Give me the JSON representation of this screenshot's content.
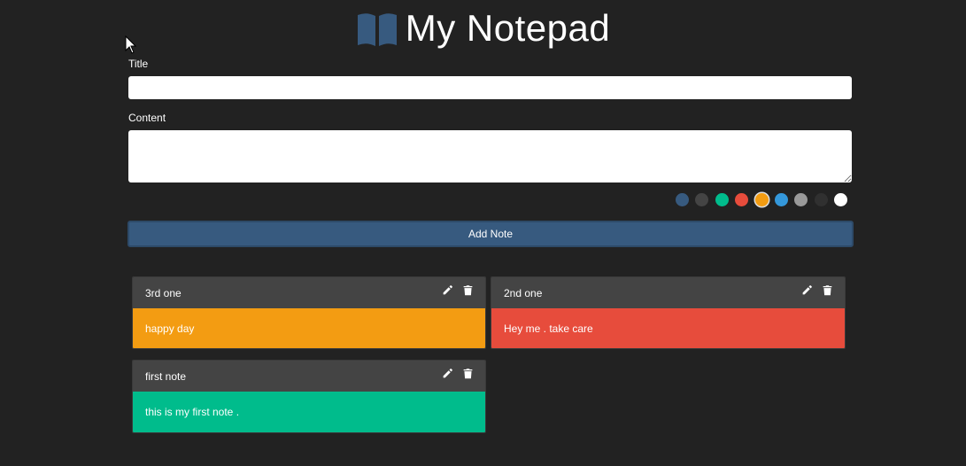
{
  "app": {
    "title": "My Notepad",
    "icon": "open-book-icon",
    "accent_color": "#375a7f"
  },
  "form": {
    "title_label": "Title",
    "title_value": "",
    "content_label": "Content",
    "content_value": "",
    "colors": [
      {
        "name": "dark-blue",
        "hex": "#375a7f",
        "selected": false
      },
      {
        "name": "dark-gray",
        "hex": "#444444",
        "selected": false
      },
      {
        "name": "green",
        "hex": "#00bc8c",
        "selected": false
      },
      {
        "name": "red",
        "hex": "#e74c3c",
        "selected": false
      },
      {
        "name": "orange",
        "hex": "#f39c12",
        "selected": true
      },
      {
        "name": "blue",
        "hex": "#3498db",
        "selected": false
      },
      {
        "name": "gray",
        "hex": "#999999",
        "selected": false
      },
      {
        "name": "near-black",
        "hex": "#303030",
        "selected": false
      },
      {
        "name": "white",
        "hex": "#ffffff",
        "selected": false
      }
    ],
    "add_button_label": "Add Note"
  },
  "notes": [
    {
      "title": "3rd one",
      "content": "happy day",
      "color": "#f39c12",
      "edit_icon": "pencil-icon",
      "delete_icon": "trash-icon"
    },
    {
      "title": "2nd one",
      "content": "Hey me . take care",
      "color": "#e74c3c",
      "edit_icon": "pencil-icon",
      "delete_icon": "trash-icon"
    },
    {
      "title": "first note",
      "content": "this is my first note .",
      "color": "#00bc8c",
      "edit_icon": "pencil-icon",
      "delete_icon": "trash-icon"
    }
  ]
}
